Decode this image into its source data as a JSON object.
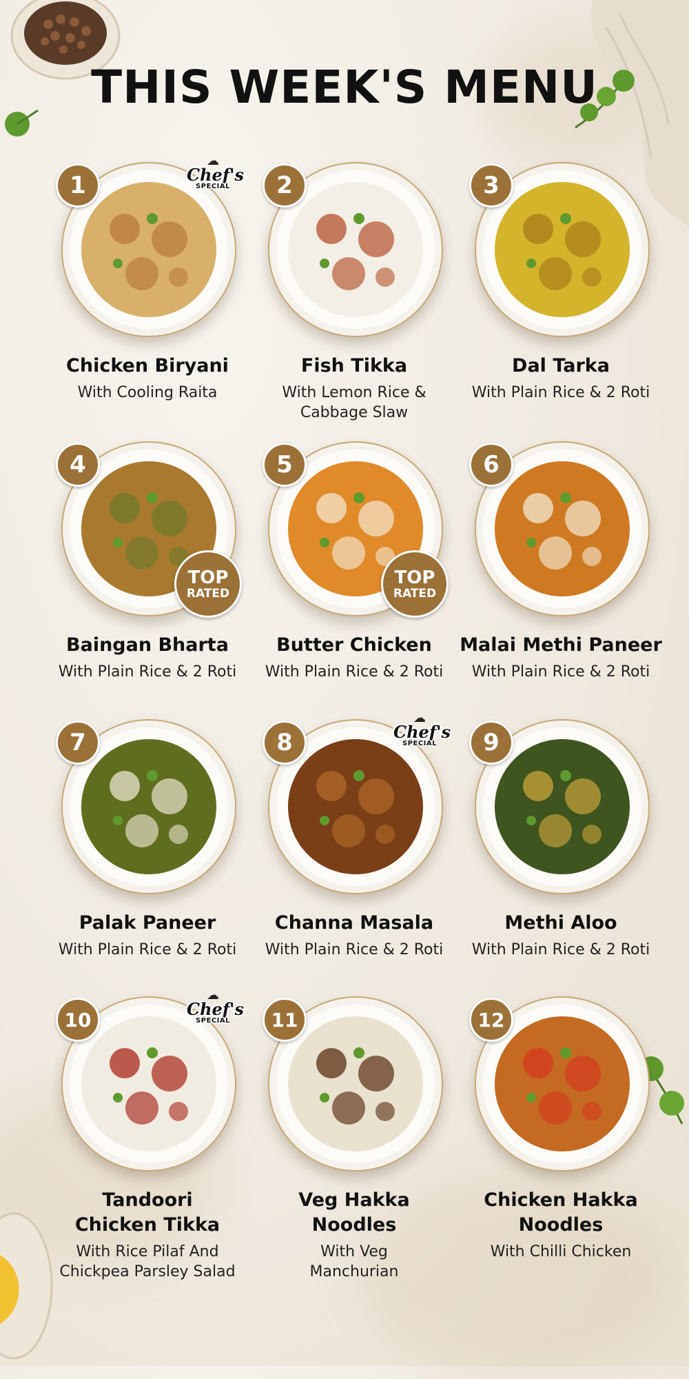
{
  "page": {
    "title": "THIS WEEK'S MENU"
  },
  "colors": {
    "badge": "#9b7138",
    "text": "#111111",
    "plate_rim": "#c9a878"
  },
  "badges": {
    "top_rated_line1": "TOP",
    "top_rated_line2": "RATED",
    "chef_line1": "Chef's",
    "chef_line2": "SPECIAL"
  },
  "menu": {
    "items": [
      {
        "number": "1",
        "name": "Chicken Biryani",
        "side": "With Cooling Raita",
        "badge": "chef",
        "food": "#d8b06a",
        "food2": "#b97a3a"
      },
      {
        "number": "2",
        "name": "Fish Tikka",
        "side": "With Lemon Rice & Cabbage Slaw",
        "badge": "",
        "food": "#f3efe6",
        "food2": "#b4512b"
      },
      {
        "number": "3",
        "name": "Dal Tarka",
        "side": "With Plain Rice & 2 Roti",
        "badge": "",
        "food": "#d4b42a",
        "food2": "#a87a1a"
      },
      {
        "number": "4",
        "name": "Baingan Bharta",
        "side": "With Plain Rice & 2 Roti",
        "badge": "top-rated",
        "food": "#a8792e",
        "food2": "#6d7a2b"
      },
      {
        "number": "5",
        "name": "Butter Chicken",
        "side": "With Plain Rice & 2 Roti",
        "badge": "top-rated",
        "food": "#e08a2a",
        "food2": "#f5e6cf"
      },
      {
        "number": "6",
        "name": "Malai Methi Paneer",
        "side": "With Plain Rice & 2 Roti",
        "badge": "",
        "food": "#cf7a22",
        "food2": "#f3e8d2"
      },
      {
        "number": "7",
        "name": "Palak Paneer",
        "side": "With Plain Rice & 2 Roti",
        "badge": "",
        "food": "#5f6e1e",
        "food2": "#eae4cf"
      },
      {
        "number": "8",
        "name": "Channa Masala",
        "side": "With Plain Rice & 2 Roti",
        "badge": "chef",
        "food": "#7a3f16",
        "food2": "#b06a2a"
      },
      {
        "number": "9",
        "name": "Methi Aloo",
        "side": "With Plain Rice & 2 Roti",
        "badge": "",
        "food": "#3f5520",
        "food2": "#c9a43a"
      },
      {
        "number": "10",
        "name": "Tandoori Chicken Tikka",
        "side": "With Rice Pilaf And Chickpea Parsley Salad",
        "badge": "chef",
        "food": "#f1ece2",
        "food2": "#a8281a"
      },
      {
        "number": "11",
        "name": "Veg Hakka Noodles",
        "side": "With Veg Manchurian",
        "badge": "",
        "food": "#e9e2cf",
        "food2": "#5a2d12"
      },
      {
        "number": "12",
        "name": "Chicken Hakka Noodles",
        "side": "With Chilli Chicken",
        "badge": "",
        "food": "#c46a22",
        "food2": "#d43a1e"
      }
    ]
  }
}
